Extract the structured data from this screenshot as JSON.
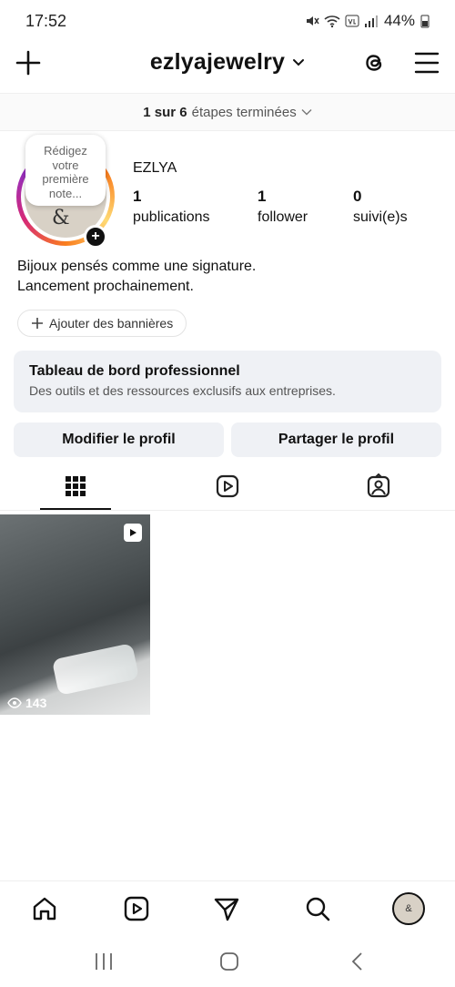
{
  "status_bar": {
    "time": "17:52",
    "icons": [
      "mute-icon",
      "wifi-icon",
      "volte-icon",
      "signal-icon"
    ],
    "battery": "44%"
  },
  "header": {
    "username": "ezlyajewelry",
    "icons": [
      "plus-icon",
      "chevron-down-icon",
      "threads-icon",
      "menu-icon"
    ]
  },
  "onboarding": {
    "progress": "1 sur 6",
    "label": "étapes terminées"
  },
  "profile": {
    "note_lines": [
      "Rédigez",
      "votre",
      "première",
      "note..."
    ],
    "avatar_monogram": "&",
    "display_name": "EZLYA",
    "stats": [
      {
        "value": "1",
        "label": "publications"
      },
      {
        "value": "1",
        "label": "follower"
      },
      {
        "value": "0",
        "label": "suivi(e)s"
      }
    ],
    "bio_lines": [
      "Bijoux pensés comme une signature.",
      "Lancement prochainement."
    ],
    "banner_button": "Ajouter des bannières"
  },
  "dashboard": {
    "title": "Tableau de bord professionnel",
    "subtitle": "Des outils et des ressources exclusifs aux entreprises."
  },
  "actions": {
    "edit": "Modifier le profil",
    "share": "Partager le profil"
  },
  "tabs": [
    "grid-icon",
    "reels-icon",
    "tagged-icon"
  ],
  "posts": [
    {
      "type": "reel",
      "views": "143"
    }
  ],
  "bottom_nav": [
    "home-icon",
    "reels-icon",
    "direct-message-icon",
    "search-icon",
    "profile-avatar"
  ],
  "colors": {
    "accent_bg": "#eff1f5",
    "text": "#111111"
  }
}
